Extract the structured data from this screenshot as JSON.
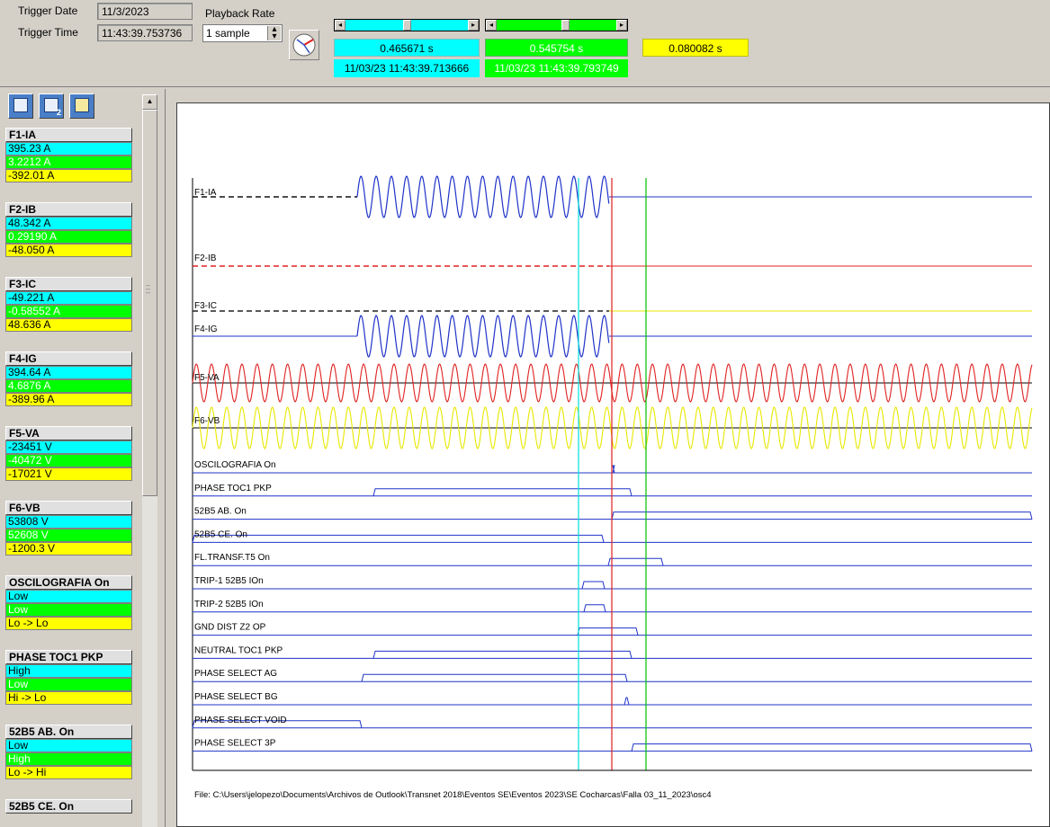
{
  "toolbar": {
    "trigger_date_label": "Trigger Date",
    "trigger_date_value": "11/3/2023",
    "trigger_time_label": "Trigger Time",
    "trigger_time_value": "11:43:39.753736",
    "playback_rate_label": "Playback Rate",
    "playback_rate_value": "1 sample",
    "cursor1_time": "0.465671 s",
    "cursor1_timestamp": "11/03/23 11:43:39.713666",
    "cursor2_time": "0.545754 s",
    "cursor2_timestamp": "11/03/23 11:43:39.793749",
    "delta_time": "0.080082 s",
    "colors": {
      "cursor1": "#00ffff",
      "cursor2": "#00ff00",
      "delta": "#ffff00"
    }
  },
  "toolbar_icons": [
    "view-single-icon",
    "view-dual-icon",
    "view-cascade-icon"
  ],
  "channels": [
    {
      "title": "F1-IA",
      "cyan": "395.23 A",
      "green": "3.2212 A",
      "yellow": "-392.01 A"
    },
    {
      "title": "F2-IB",
      "cyan": "48.342 A",
      "green": "0.29190 A",
      "yellow": "-48.050 A"
    },
    {
      "title": "F3-IC",
      "cyan": "-49.221 A",
      "green": "-0.58552 A",
      "yellow": "48.636 A"
    },
    {
      "title": "F4-IG",
      "cyan": "394.64 A",
      "green": "4.6876 A",
      "yellow": "-389.96 A"
    },
    {
      "title": "F5-VA",
      "cyan": "-23451 V",
      "green": "-40472 V",
      "yellow": "-17021 V"
    },
    {
      "title": "F6-VB",
      "cyan": "53808 V",
      "green": "52608 V",
      "yellow": "-1200.3 V"
    },
    {
      "title": "OSCILOGRAFIA On",
      "cyan": "Low",
      "green": "Low",
      "yellow": "Lo -> Lo"
    },
    {
      "title": "PHASE TOC1 PKP",
      "cyan": "High",
      "green": "Low",
      "yellow": "Hi -> Lo"
    },
    {
      "title": "52B5 AB.   On",
      "cyan": "Low",
      "green": "High",
      "yellow": "Lo -> Hi"
    },
    {
      "title": "52B5 CE.   On",
      "cyan": "",
      "green": "",
      "yellow": ""
    }
  ],
  "plot": {
    "analog_traces": [
      {
        "label": "F1-IA",
        "color": "#1f33c8"
      },
      {
        "label": "F2-IB",
        "color": "#e02020"
      },
      {
        "label": "F3-IC",
        "color": "#e8e800"
      },
      {
        "label": "F4-IG",
        "color": "#1f33c8"
      },
      {
        "label": "F5-VA",
        "color": "#e02020"
      },
      {
        "label": "F6-VB",
        "color": "#e8e800"
      }
    ],
    "digital_traces": [
      "OSCILOGRAFIA On",
      "PHASE TOC1 PKP",
      "52B5 AB.   On",
      "52B5 CE.   On",
      "FL.TRANSF.T5 On",
      "TRIP-1 52B5  IOn",
      "TRIP-2 52B5  IOn",
      "GND DIST Z2 OP",
      "NEUTRAL TOC1 PKP",
      "PHASE SELECT AG",
      "PHASE SELECT BG",
      "PHASE SELECT VOID",
      "PHASE SELECT 3P"
    ],
    "file_path": "File: C:\\Users\\jelopezo\\Documents\\Archivos de Outlook\\Transnet 2018\\Eventos SE\\Eventos 2023\\SE Cocharcas\\Falla 03_11_2023\\osc4",
    "cursor_colors": {
      "cyan": "#00e0e0",
      "red": "#e02020",
      "green": "#00c000"
    }
  }
}
